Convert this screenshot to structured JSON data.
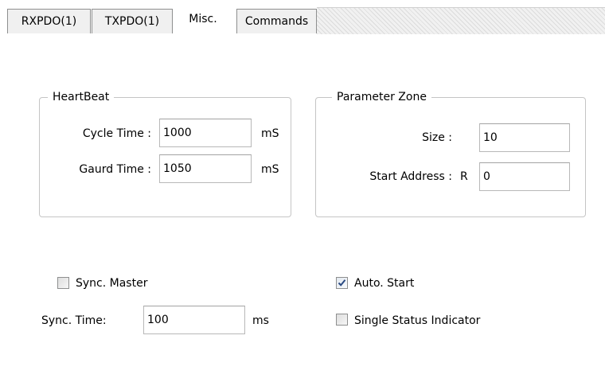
{
  "tabs": [
    {
      "label": "RXPDO(1)",
      "active": false
    },
    {
      "label": "TXPDO(1)",
      "active": false
    },
    {
      "label": "Misc.",
      "active": true
    },
    {
      "label": "Commands",
      "active": false
    }
  ],
  "heartbeat": {
    "title": "HeartBeat",
    "cycle_time": {
      "label": "Cycle Time :",
      "value": "1000",
      "unit": "mS"
    },
    "guard_time": {
      "label": "Gaurd Time :",
      "value": "1050",
      "unit": "mS"
    }
  },
  "parameter_zone": {
    "title": "Parameter Zone",
    "size": {
      "label": "Size :",
      "value": "10"
    },
    "start_address": {
      "label": "Start Address :",
      "prefix": "R",
      "value": "0"
    }
  },
  "sync": {
    "master": {
      "label": "Sync. Master",
      "checked": false
    },
    "time": {
      "label": "Sync. Time:",
      "value": "100",
      "unit": "ms"
    }
  },
  "options": {
    "auto_start": {
      "label": "Auto. Start",
      "checked": true
    },
    "single_status": {
      "label": "Single Status Indicator",
      "checked": false
    }
  },
  "colors": {
    "border": "#8e8f8f",
    "group_border": "#c5c5c5",
    "check_mark": "#2a4a82"
  }
}
